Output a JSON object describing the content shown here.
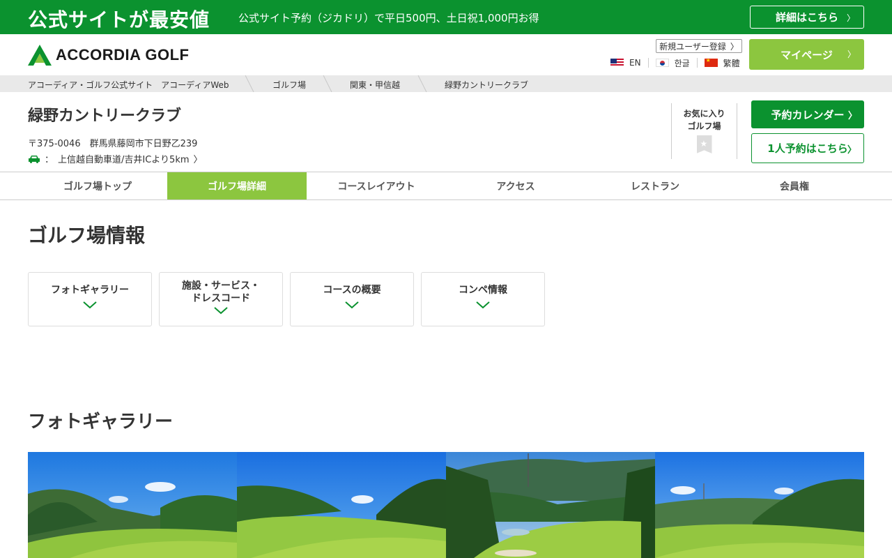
{
  "promo": {
    "title": "公式サイトが最安値",
    "text": "公式サイト予約（ジカドリ）で平日500円、土日祝1,000円お得",
    "button": "詳細はこちら"
  },
  "header": {
    "logo_text": "ACCORDIA GOLF",
    "register": "新規ユーザー登録",
    "languages": [
      "EN",
      "한글",
      "繁體"
    ],
    "mypage": "マイページ"
  },
  "breadcrumb": [
    "アコーディア・ゴルフ公式サイト　アコーディアWeb",
    "ゴルフ場",
    "関東・甲信越",
    "緑野カントリークラブ"
  ],
  "course": {
    "name": "緑野カントリークラブ",
    "address": "〒375-0046　群馬県藤岡市下日野乙239",
    "access_label": "：",
    "access": "上信越自動車道/吉井ICより5km",
    "fav_line1": "お気に入り",
    "fav_line2": "ゴルフ場",
    "calendar_button": "予約カレンダー",
    "solo_button": "1人予約はこちら"
  },
  "tabs": [
    {
      "label": "ゴルフ場トップ"
    },
    {
      "label": "ゴルフ場詳細",
      "active": true
    },
    {
      "label": "コースレイアウト"
    },
    {
      "label": "アクセス"
    },
    {
      "label": "レストラン"
    },
    {
      "label": "会員権"
    }
  ],
  "section": {
    "title": "ゴルフ場情報",
    "cards": [
      "フォトギャラリー",
      "施設・サービス・\nドレスコード",
      "コースの概要",
      "コンペ情報"
    ],
    "gallery_title": "フォトギャラリー"
  },
  "colors": {
    "brand_green": "#0b922f",
    "light_green": "#8cc63f"
  },
  "icons": [
    "chevron-right-icon",
    "car-icon",
    "bookmark-star-icon",
    "chevron-down-icon",
    "accordia-logo-icon"
  ]
}
